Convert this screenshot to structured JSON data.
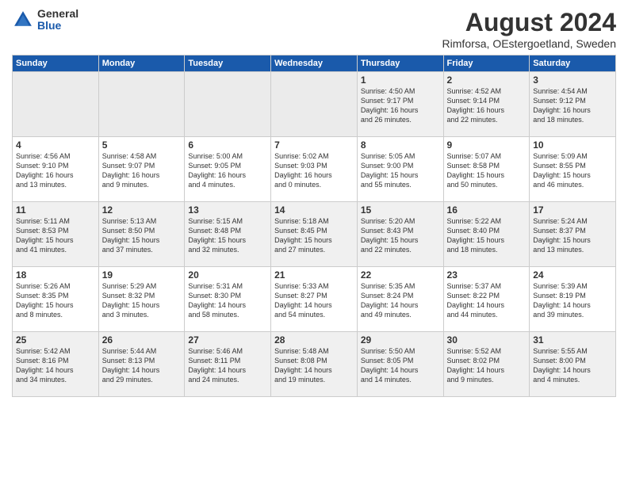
{
  "logo": {
    "general": "General",
    "blue": "Blue"
  },
  "title": "August 2024",
  "subtitle": "Rimforsa, OEstergoetland, Sweden",
  "days_header": [
    "Sunday",
    "Monday",
    "Tuesday",
    "Wednesday",
    "Thursday",
    "Friday",
    "Saturday"
  ],
  "weeks": [
    [
      {
        "day": "",
        "info": ""
      },
      {
        "day": "",
        "info": ""
      },
      {
        "day": "",
        "info": ""
      },
      {
        "day": "",
        "info": ""
      },
      {
        "day": "1",
        "info": "Sunrise: 4:50 AM\nSunset: 9:17 PM\nDaylight: 16 hours\nand 26 minutes."
      },
      {
        "day": "2",
        "info": "Sunrise: 4:52 AM\nSunset: 9:14 PM\nDaylight: 16 hours\nand 22 minutes."
      },
      {
        "day": "3",
        "info": "Sunrise: 4:54 AM\nSunset: 9:12 PM\nDaylight: 16 hours\nand 18 minutes."
      }
    ],
    [
      {
        "day": "4",
        "info": "Sunrise: 4:56 AM\nSunset: 9:10 PM\nDaylight: 16 hours\nand 13 minutes."
      },
      {
        "day": "5",
        "info": "Sunrise: 4:58 AM\nSunset: 9:07 PM\nDaylight: 16 hours\nand 9 minutes."
      },
      {
        "day": "6",
        "info": "Sunrise: 5:00 AM\nSunset: 9:05 PM\nDaylight: 16 hours\nand 4 minutes."
      },
      {
        "day": "7",
        "info": "Sunrise: 5:02 AM\nSunset: 9:03 PM\nDaylight: 16 hours\nand 0 minutes."
      },
      {
        "day": "8",
        "info": "Sunrise: 5:05 AM\nSunset: 9:00 PM\nDaylight: 15 hours\nand 55 minutes."
      },
      {
        "day": "9",
        "info": "Sunrise: 5:07 AM\nSunset: 8:58 PM\nDaylight: 15 hours\nand 50 minutes."
      },
      {
        "day": "10",
        "info": "Sunrise: 5:09 AM\nSunset: 8:55 PM\nDaylight: 15 hours\nand 46 minutes."
      }
    ],
    [
      {
        "day": "11",
        "info": "Sunrise: 5:11 AM\nSunset: 8:53 PM\nDaylight: 15 hours\nand 41 minutes."
      },
      {
        "day": "12",
        "info": "Sunrise: 5:13 AM\nSunset: 8:50 PM\nDaylight: 15 hours\nand 37 minutes."
      },
      {
        "day": "13",
        "info": "Sunrise: 5:15 AM\nSunset: 8:48 PM\nDaylight: 15 hours\nand 32 minutes."
      },
      {
        "day": "14",
        "info": "Sunrise: 5:18 AM\nSunset: 8:45 PM\nDaylight: 15 hours\nand 27 minutes."
      },
      {
        "day": "15",
        "info": "Sunrise: 5:20 AM\nSunset: 8:43 PM\nDaylight: 15 hours\nand 22 minutes."
      },
      {
        "day": "16",
        "info": "Sunrise: 5:22 AM\nSunset: 8:40 PM\nDaylight: 15 hours\nand 18 minutes."
      },
      {
        "day": "17",
        "info": "Sunrise: 5:24 AM\nSunset: 8:37 PM\nDaylight: 15 hours\nand 13 minutes."
      }
    ],
    [
      {
        "day": "18",
        "info": "Sunrise: 5:26 AM\nSunset: 8:35 PM\nDaylight: 15 hours\nand 8 minutes."
      },
      {
        "day": "19",
        "info": "Sunrise: 5:29 AM\nSunset: 8:32 PM\nDaylight: 15 hours\nand 3 minutes."
      },
      {
        "day": "20",
        "info": "Sunrise: 5:31 AM\nSunset: 8:30 PM\nDaylight: 14 hours\nand 58 minutes."
      },
      {
        "day": "21",
        "info": "Sunrise: 5:33 AM\nSunset: 8:27 PM\nDaylight: 14 hours\nand 54 minutes."
      },
      {
        "day": "22",
        "info": "Sunrise: 5:35 AM\nSunset: 8:24 PM\nDaylight: 14 hours\nand 49 minutes."
      },
      {
        "day": "23",
        "info": "Sunrise: 5:37 AM\nSunset: 8:22 PM\nDaylight: 14 hours\nand 44 minutes."
      },
      {
        "day": "24",
        "info": "Sunrise: 5:39 AM\nSunset: 8:19 PM\nDaylight: 14 hours\nand 39 minutes."
      }
    ],
    [
      {
        "day": "25",
        "info": "Sunrise: 5:42 AM\nSunset: 8:16 PM\nDaylight: 14 hours\nand 34 minutes."
      },
      {
        "day": "26",
        "info": "Sunrise: 5:44 AM\nSunset: 8:13 PM\nDaylight: 14 hours\nand 29 minutes."
      },
      {
        "day": "27",
        "info": "Sunrise: 5:46 AM\nSunset: 8:11 PM\nDaylight: 14 hours\nand 24 minutes."
      },
      {
        "day": "28",
        "info": "Sunrise: 5:48 AM\nSunset: 8:08 PM\nDaylight: 14 hours\nand 19 minutes."
      },
      {
        "day": "29",
        "info": "Sunrise: 5:50 AM\nSunset: 8:05 PM\nDaylight: 14 hours\nand 14 minutes."
      },
      {
        "day": "30",
        "info": "Sunrise: 5:52 AM\nSunset: 8:02 PM\nDaylight: 14 hours\nand 9 minutes."
      },
      {
        "day": "31",
        "info": "Sunrise: 5:55 AM\nSunset: 8:00 PM\nDaylight: 14 hours\nand 4 minutes."
      }
    ]
  ]
}
